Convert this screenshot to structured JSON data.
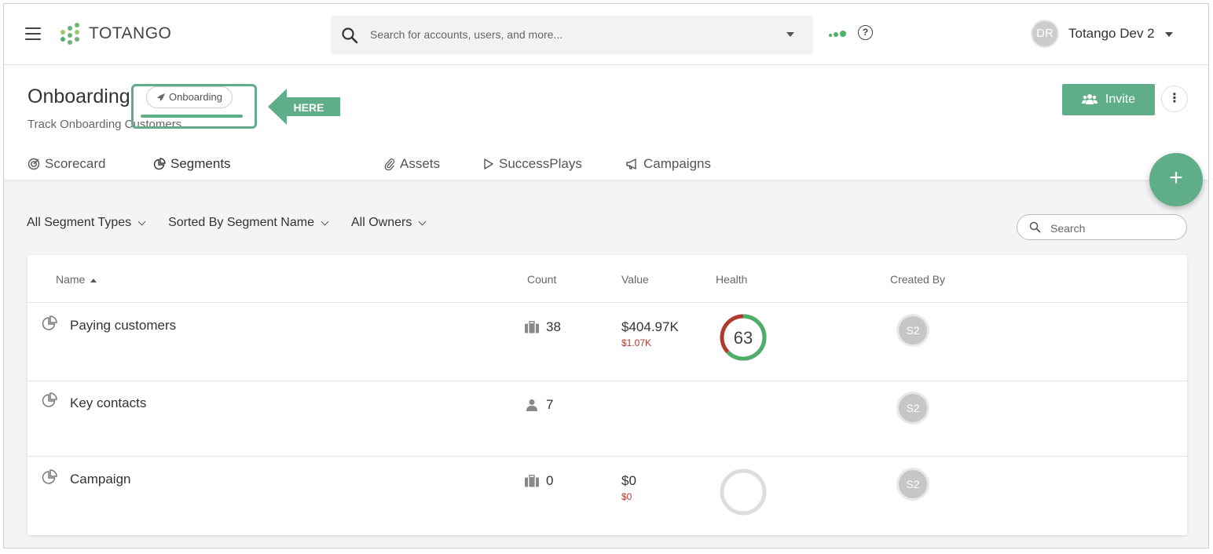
{
  "topbar": {
    "logo_text": "TOTANGO",
    "search_placeholder": "Search for accounts, users, and more...",
    "help_glyph": "?",
    "user_initials": "DR",
    "user_name": "Totango Dev 2"
  },
  "header": {
    "title": "Onboarding",
    "badge": "Onboarding",
    "subtitle": "Track Onboarding Customers",
    "invite_label": "Invite",
    "kebab_glyph": "⋮",
    "fab_glyph": "+"
  },
  "tabs": [
    {
      "label": "Scorecard",
      "icon": "target-icon"
    },
    {
      "label": "Segments",
      "icon": "pie-chart-icon",
      "active": true
    },
    {
      "label": "Assets",
      "icon": "paperclip-icon"
    },
    {
      "label": "SuccessPlays",
      "icon": "play-icon"
    },
    {
      "label": "Campaigns",
      "icon": "megaphone-icon"
    }
  ],
  "annotation": {
    "arrow_label": "HERE"
  },
  "filters": {
    "types": "All Segment Types",
    "sort": "Sorted By Segment Name",
    "owners": "All Owners",
    "search_placeholder": "Search"
  },
  "table": {
    "columns": [
      "Name",
      "Count",
      "Value",
      "Health",
      "Created By"
    ],
    "rows": [
      {
        "name": "Paying customers",
        "count_icon": "briefcase-icon",
        "count": "38",
        "value": "$404.97K",
        "value_sub": "$1.07K",
        "health": "63",
        "health_fraction": 0.63,
        "creator": "S2"
      },
      {
        "name": "Key contacts",
        "count_icon": "person-icon",
        "count": "7",
        "value": "",
        "value_sub": "",
        "health": "",
        "creator": "S2"
      },
      {
        "name": "Campaign",
        "count_icon": "briefcase-icon",
        "count": "0",
        "value": "$0",
        "value_sub": "$0",
        "health": "",
        "health_fraction": 0,
        "creator": "S2"
      }
    ]
  },
  "colors": {
    "accent": "#5fae89",
    "health_good": "#4caf6a",
    "health_bad": "#b03a2e",
    "empty_ring": "#dddddd"
  }
}
